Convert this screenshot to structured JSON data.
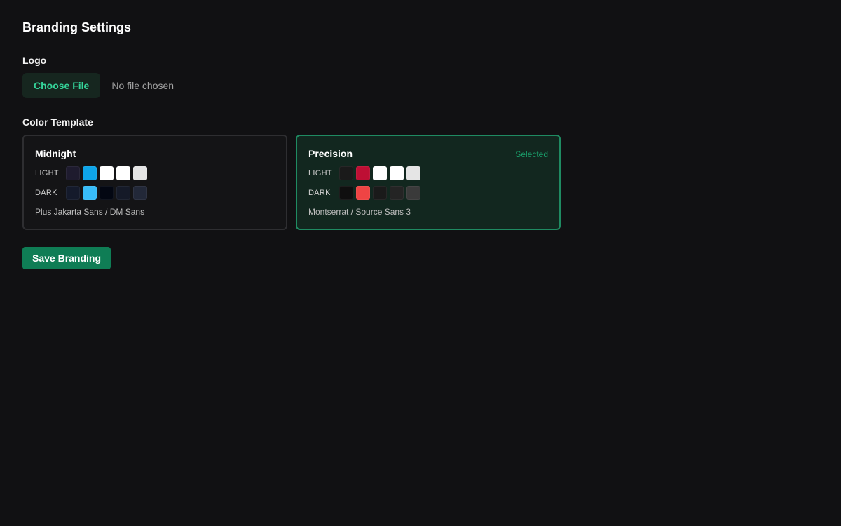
{
  "page": {
    "title": "Branding Settings"
  },
  "logo": {
    "label": "Logo",
    "choose_label": "Choose File",
    "status": "No file chosen"
  },
  "color_template": {
    "label": "Color Template",
    "templates": [
      {
        "name": "Midnight",
        "selected": false,
        "fonts": "Plus Jakarta Sans / DM Sans",
        "light_label": "LIGHT",
        "dark_label": "DARK",
        "light": [
          "#1e1b2e",
          "#0ea5e9",
          "#ffffff",
          "#ffffff",
          "#e5e5e5"
        ],
        "dark": [
          "#141a2b",
          "#38bdf8",
          "#030712",
          "#151a28",
          "#222838"
        ]
      },
      {
        "name": "Precision",
        "selected": true,
        "selected_label": "Selected",
        "fonts": "Montserrat / Source Sans 3",
        "light_label": "LIGHT",
        "dark_label": "DARK",
        "light": [
          "#1a1a1a",
          "#be0f34",
          "#ffffff",
          "#ffffff",
          "#e5e5e5"
        ],
        "dark": [
          "#0f0f0f",
          "#ef4444",
          "#1a1a1a",
          "#242424",
          "#3a3a3a"
        ]
      }
    ]
  },
  "actions": {
    "save_label": "Save Branding"
  }
}
